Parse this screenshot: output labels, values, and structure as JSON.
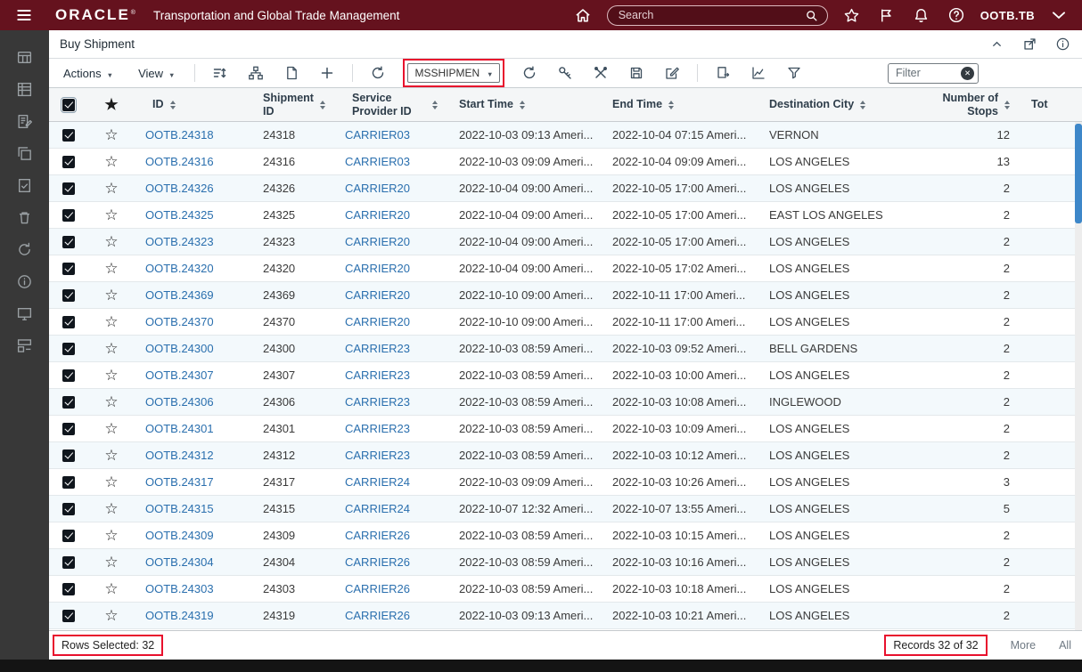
{
  "topbar": {
    "brand": "ORACLE",
    "brand_mark": "®",
    "app_title": "Transportation and Global Trade Management",
    "search_placeholder": "Search",
    "username": "OOTB.TB"
  },
  "panel": {
    "title": "Buy Shipment"
  },
  "toolbar": {
    "actions_label": "Actions",
    "view_label": "View",
    "saved_search_value": "MSSHIPMEN",
    "filter_placeholder": "Filter"
  },
  "table": {
    "columns": [
      {
        "label": "ID"
      },
      {
        "label": "Shipment ID"
      },
      {
        "label": "Service Provider ID"
      },
      {
        "label": "Start Time"
      },
      {
        "label": "End Time"
      },
      {
        "label": "Destination City"
      },
      {
        "label": "Number of Stops"
      },
      {
        "label": "Tot"
      }
    ],
    "rows": [
      {
        "id": "OOTB.24318",
        "shipment_id": "24318",
        "service_provider": "CARRIER03",
        "start_time": "2022-10-03 09:13 Ameri...",
        "end_time": "2022-10-04 07:15 Ameri...",
        "destination_city": "VERNON",
        "stops": "12"
      },
      {
        "id": "OOTB.24316",
        "shipment_id": "24316",
        "service_provider": "CARRIER03",
        "start_time": "2022-10-03 09:09 Ameri...",
        "end_time": "2022-10-04 09:09 Ameri...",
        "destination_city": "LOS ANGELES",
        "stops": "13"
      },
      {
        "id": "OOTB.24326",
        "shipment_id": "24326",
        "service_provider": "CARRIER20",
        "start_time": "2022-10-04 09:00 Ameri...",
        "end_time": "2022-10-05 17:00 Ameri...",
        "destination_city": "LOS ANGELES",
        "stops": "2"
      },
      {
        "id": "OOTB.24325",
        "shipment_id": "24325",
        "service_provider": "CARRIER20",
        "start_time": "2022-10-04 09:00 Ameri...",
        "end_time": "2022-10-05 17:00 Ameri...",
        "destination_city": "EAST LOS ANGELES",
        "stops": "2"
      },
      {
        "id": "OOTB.24323",
        "shipment_id": "24323",
        "service_provider": "CARRIER20",
        "start_time": "2022-10-04 09:00 Ameri...",
        "end_time": "2022-10-05 17:00 Ameri...",
        "destination_city": "LOS ANGELES",
        "stops": "2"
      },
      {
        "id": "OOTB.24320",
        "shipment_id": "24320",
        "service_provider": "CARRIER20",
        "start_time": "2022-10-04 09:00 Ameri...",
        "end_time": "2022-10-05 17:02 Ameri...",
        "destination_city": "LOS ANGELES",
        "stops": "2"
      },
      {
        "id": "OOTB.24369",
        "shipment_id": "24369",
        "service_provider": "CARRIER20",
        "start_time": "2022-10-10 09:00 Ameri...",
        "end_time": "2022-10-11 17:00 Ameri...",
        "destination_city": "LOS ANGELES",
        "stops": "2"
      },
      {
        "id": "OOTB.24370",
        "shipment_id": "24370",
        "service_provider": "CARRIER20",
        "start_time": "2022-10-10 09:00 Ameri...",
        "end_time": "2022-10-11 17:00 Ameri...",
        "destination_city": "LOS ANGELES",
        "stops": "2"
      },
      {
        "id": "OOTB.24300",
        "shipment_id": "24300",
        "service_provider": "CARRIER23",
        "start_time": "2022-10-03 08:59 Ameri...",
        "end_time": "2022-10-03 09:52 Ameri...",
        "destination_city": "BELL GARDENS",
        "stops": "2"
      },
      {
        "id": "OOTB.24307",
        "shipment_id": "24307",
        "service_provider": "CARRIER23",
        "start_time": "2022-10-03 08:59 Ameri...",
        "end_time": "2022-10-03 10:00 Ameri...",
        "destination_city": "LOS ANGELES",
        "stops": "2"
      },
      {
        "id": "OOTB.24306",
        "shipment_id": "24306",
        "service_provider": "CARRIER23",
        "start_time": "2022-10-03 08:59 Ameri...",
        "end_time": "2022-10-03 10:08 Ameri...",
        "destination_city": "INGLEWOOD",
        "stops": "2"
      },
      {
        "id": "OOTB.24301",
        "shipment_id": "24301",
        "service_provider": "CARRIER23",
        "start_time": "2022-10-03 08:59 Ameri...",
        "end_time": "2022-10-03 10:09 Ameri...",
        "destination_city": "LOS ANGELES",
        "stops": "2"
      },
      {
        "id": "OOTB.24312",
        "shipment_id": "24312",
        "service_provider": "CARRIER23",
        "start_time": "2022-10-03 08:59 Ameri...",
        "end_time": "2022-10-03 10:12 Ameri...",
        "destination_city": "LOS ANGELES",
        "stops": "2"
      },
      {
        "id": "OOTB.24317",
        "shipment_id": "24317",
        "service_provider": "CARRIER24",
        "start_time": "2022-10-03 09:09 Ameri...",
        "end_time": "2022-10-03 10:26 Ameri...",
        "destination_city": "LOS ANGELES",
        "stops": "3"
      },
      {
        "id": "OOTB.24315",
        "shipment_id": "24315",
        "service_provider": "CARRIER24",
        "start_time": "2022-10-07 12:32 Ameri...",
        "end_time": "2022-10-07 13:55 Ameri...",
        "destination_city": "LOS ANGELES",
        "stops": "5"
      },
      {
        "id": "OOTB.24309",
        "shipment_id": "24309",
        "service_provider": "CARRIER26",
        "start_time": "2022-10-03 08:59 Ameri...",
        "end_time": "2022-10-03 10:15 Ameri...",
        "destination_city": "LOS ANGELES",
        "stops": "2"
      },
      {
        "id": "OOTB.24304",
        "shipment_id": "24304",
        "service_provider": "CARRIER26",
        "start_time": "2022-10-03 08:59 Ameri...",
        "end_time": "2022-10-03 10:16 Ameri...",
        "destination_city": "LOS ANGELES",
        "stops": "2"
      },
      {
        "id": "OOTB.24303",
        "shipment_id": "24303",
        "service_provider": "CARRIER26",
        "start_time": "2022-10-03 08:59 Ameri...",
        "end_time": "2022-10-03 10:18 Ameri...",
        "destination_city": "LOS ANGELES",
        "stops": "2"
      },
      {
        "id": "OOTB.24319",
        "shipment_id": "24319",
        "service_provider": "CARRIER26",
        "start_time": "2022-10-03 09:13 Ameri...",
        "end_time": "2022-10-03 10:21 Ameri...",
        "destination_city": "LOS ANGELES",
        "stops": "2"
      }
    ]
  },
  "footer": {
    "rows_selected": "Rows Selected: 32",
    "records": "Records 32 of 32",
    "more_label": "More",
    "all_label": "All"
  },
  "colors": {
    "header_bar": "#65121E",
    "annotation_red": "#E8112D",
    "link_blue": "#2A6FAE",
    "scrollbar_blue": "#3D87C9"
  },
  "icons": {
    "topbar": [
      "menu-icon",
      "home-icon",
      "search-icon",
      "star-icon",
      "flag-icon",
      "bell-icon",
      "help-icon",
      "chevron-down-icon"
    ],
    "sidebar": [
      "grid-icon",
      "table-icon",
      "form-edit-icon",
      "copy-icon",
      "document-check-icon",
      "trash-icon",
      "refresh-icon",
      "info-icon",
      "monitor-icon",
      "related-table-icon"
    ],
    "toolbar": [
      "sort-columns-icon",
      "hierarchy-icon",
      "new-document-icon",
      "add-icon",
      "reload-icon",
      "refresh-icon",
      "key-icon",
      "tools-icon",
      "save-icon",
      "edit-icon",
      "export-icon",
      "chart-icon",
      "filter-funnel-icon",
      "clear-icon"
    ],
    "table": [
      "checkbox",
      "star-outline",
      "sort-icon"
    ]
  }
}
